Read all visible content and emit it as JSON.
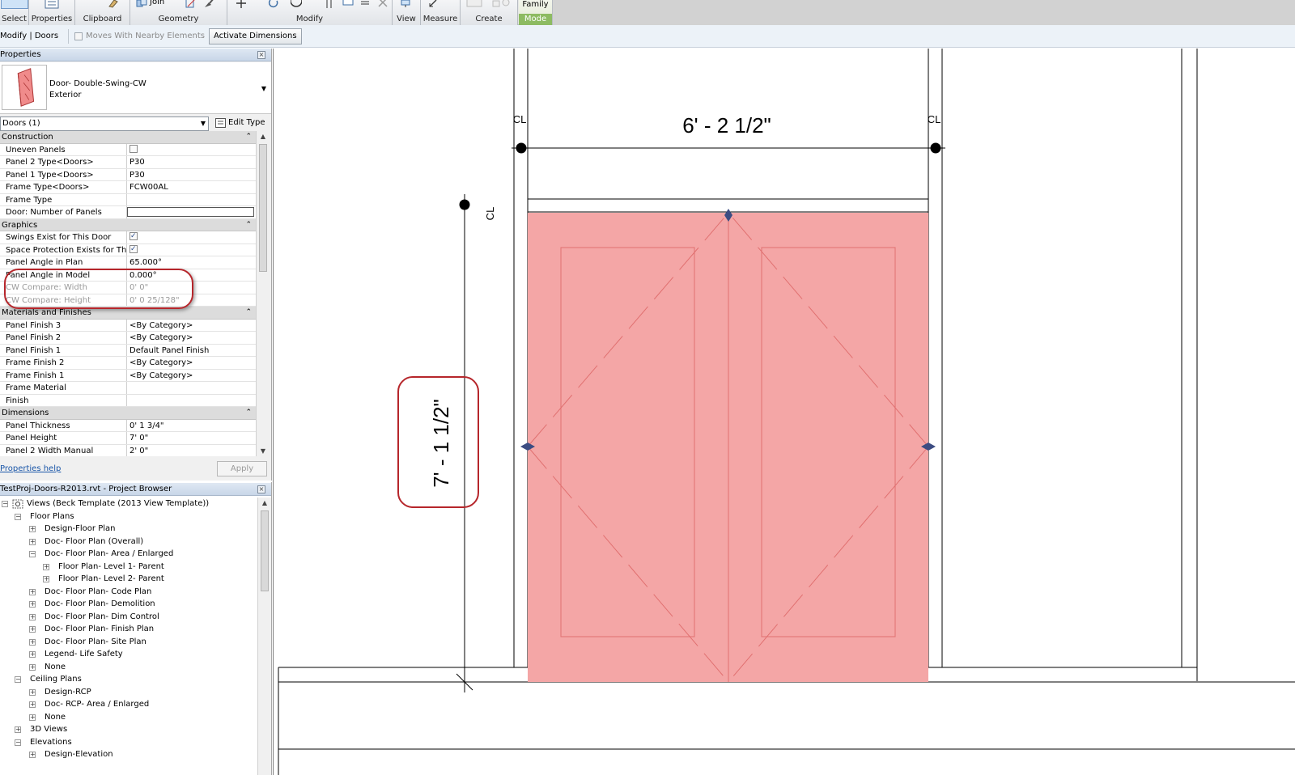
{
  "ribbon": {
    "groups": [
      {
        "label": "Select",
        "icon": "select-icon"
      },
      {
        "label": "Properties",
        "icon": "properties-icon"
      },
      {
        "label": "Clipboard",
        "icon": "clipboard-icon"
      },
      {
        "label": "Geometry",
        "icon": "geometry-icon",
        "join_label": "Join"
      },
      {
        "label": "Modify",
        "icon": "modify-icon"
      },
      {
        "label": "View",
        "icon": "view-icon"
      },
      {
        "label": "Measure",
        "icon": "measure-icon"
      },
      {
        "label": "Create",
        "icon": "create-icon"
      },
      {
        "label": "Family",
        "mode_label": "Mode",
        "icon": "family-icon"
      }
    ]
  },
  "options_bar": {
    "context": "Modify | Doors",
    "moves_with_nearby": "Moves With Nearby Elements",
    "moves_checked": false,
    "activate_dimensions": "Activate Dimensions"
  },
  "properties": {
    "title": "Properties",
    "type_name": "Door- Double-Swing-CW",
    "type_sub": "Exterior",
    "instance_filter": "Doors (1)",
    "edit_type": "Edit Type",
    "sections": [
      {
        "name": "Construction",
        "rows": [
          {
            "name": "Uneven Panels",
            "kind": "checkbox",
            "checked": false
          },
          {
            "name": "Panel 2 Type<Doors>",
            "value": "P30"
          },
          {
            "name": "Panel 1 Type<Doors>",
            "value": "P30"
          },
          {
            "name": "Frame Type<Doors>",
            "value": "FCW00AL"
          },
          {
            "name": "Frame Type",
            "value": ""
          },
          {
            "name": "Door: Number of Panels",
            "kind": "field",
            "value": ""
          }
        ]
      },
      {
        "name": "Graphics",
        "rows": [
          {
            "name": "Swings Exist for This Door",
            "kind": "checkbox",
            "checked": true
          },
          {
            "name": "Space Protection Exists for This...",
            "kind": "checkbox",
            "checked": true
          },
          {
            "name": "Panel Angle in Plan",
            "value": "65.000°"
          },
          {
            "name": "Panel Angle in Model",
            "value": "0.000°"
          },
          {
            "name": "CW Compare: Width",
            "value": "0'  0\"",
            "readonly": true
          },
          {
            "name": "CW Compare: Height",
            "value": "0'  0 25/128\"",
            "readonly": true
          }
        ]
      },
      {
        "name": "Materials and Finishes",
        "rows": [
          {
            "name": "Panel Finish 3",
            "value": "<By Category>"
          },
          {
            "name": "Panel Finish 2",
            "value": "<By Category>"
          },
          {
            "name": "Panel Finish 1",
            "value": "Default Panel Finish"
          },
          {
            "name": "Frame Finish 2",
            "value": "<By Category>"
          },
          {
            "name": "Frame Finish 1",
            "value": "<By Category>"
          },
          {
            "name": "Frame Material",
            "value": ""
          },
          {
            "name": "Finish",
            "value": ""
          }
        ]
      },
      {
        "name": "Dimensions",
        "rows": [
          {
            "name": "Panel Thickness",
            "value": "0'  1 3/4\""
          },
          {
            "name": "Panel Height",
            "value": "7'  0\""
          },
          {
            "name": "Panel 2 Width Manual",
            "value": "2'  0\""
          }
        ]
      }
    ],
    "help": "Properties help",
    "apply": "Apply"
  },
  "browser": {
    "title": "TestProj-Doors-R2013.rvt - Project Browser",
    "items": [
      {
        "label": "Views (Beck Template (2013 View Template))",
        "level": 0,
        "toggle": "-",
        "icon": "views-icon"
      },
      {
        "label": "Floor Plans",
        "level": 1,
        "toggle": "-"
      },
      {
        "label": "Design-Floor Plan",
        "level": 2,
        "toggle": "+"
      },
      {
        "label": "Doc- Floor Plan (Overall)",
        "level": 2,
        "toggle": "+"
      },
      {
        "label": "Doc- Floor Plan- Area / Enlarged",
        "level": 2,
        "toggle": "-"
      },
      {
        "label": "Floor Plan- Level 1- Parent",
        "level": 3,
        "toggle": "+"
      },
      {
        "label": "Floor Plan- Level 2- Parent",
        "level": 3,
        "toggle": "+"
      },
      {
        "label": "Doc- Floor Plan- Code Plan",
        "level": 2,
        "toggle": "+"
      },
      {
        "label": "Doc- Floor Plan- Demolition",
        "level": 2,
        "toggle": "+"
      },
      {
        "label": "Doc- Floor Plan- Dim Control",
        "level": 2,
        "toggle": "+"
      },
      {
        "label": "Doc- Floor Plan- Finish Plan",
        "level": 2,
        "toggle": "+"
      },
      {
        "label": "Doc- Floor Plan- Site Plan",
        "level": 2,
        "toggle": "+"
      },
      {
        "label": "Legend- Life Safety",
        "level": 2,
        "toggle": "+"
      },
      {
        "label": "None",
        "level": 2,
        "toggle": "+"
      },
      {
        "label": "Ceiling Plans",
        "level": 1,
        "toggle": "-"
      },
      {
        "label": "Design-RCP",
        "level": 2,
        "toggle": "+"
      },
      {
        "label": "Doc- RCP- Area / Enlarged",
        "level": 2,
        "toggle": "+"
      },
      {
        "label": "None",
        "level": 2,
        "toggle": "+"
      },
      {
        "label": "3D Views",
        "level": 1,
        "toggle": "+"
      },
      {
        "label": "Elevations",
        "level": 1,
        "toggle": "-"
      },
      {
        "label": "Design-Elevation",
        "level": 2,
        "toggle": "+"
      }
    ]
  },
  "canvas": {
    "width_dimension": "6' - 2 1/2\"",
    "height_dimension": "7' - 1 1/2\"",
    "cl_label": "CL",
    "door_color": "#f4a6a6",
    "panel_line_color": "#e07070",
    "callout_color": "#b6262b"
  }
}
